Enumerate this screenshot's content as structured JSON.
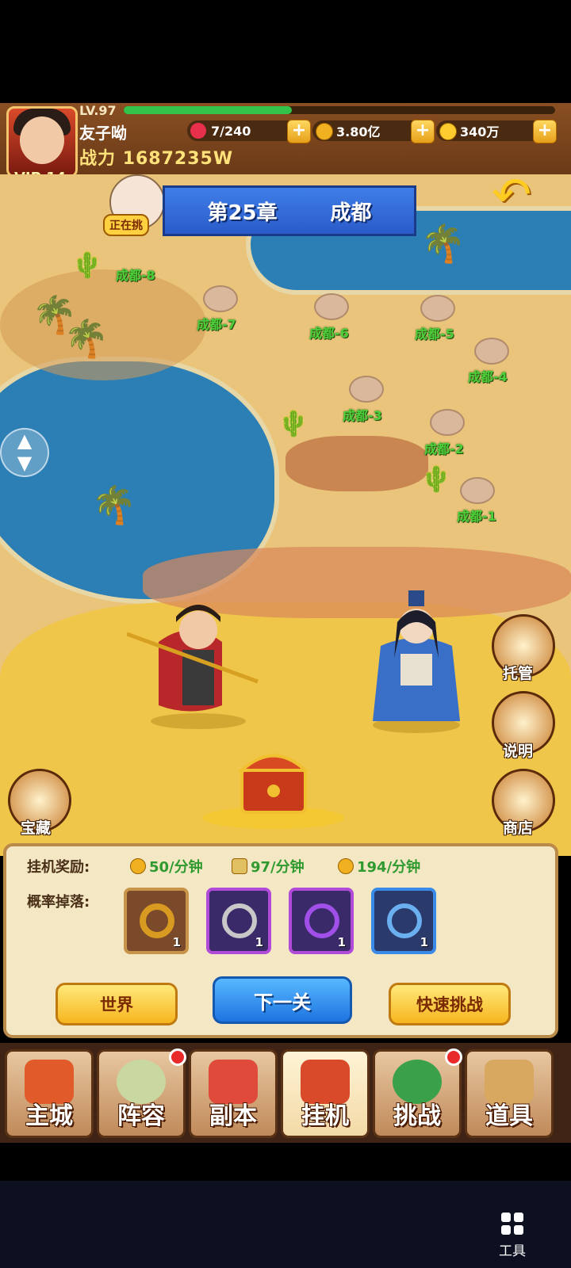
{
  "player": {
    "level": "LV.97",
    "xp_fraction": 0.39,
    "name": "友子呦",
    "power_label": "战力",
    "power_value": "1687235W",
    "vip": "VIP 14"
  },
  "resources": [
    {
      "name": "stamina",
      "icon": "heart-icon",
      "value": "7/240"
    },
    {
      "name": "silver",
      "icon": "coin-icon",
      "value": "3.80亿"
    },
    {
      "name": "gold",
      "icon": "gold-icon",
      "value": "340万"
    }
  ],
  "map": {
    "chapter": "第25章",
    "city": "成都",
    "current_tag": "正在挑",
    "stages": [
      "成都-1",
      "成都-2",
      "成都-3",
      "成都-4",
      "成都-5",
      "成都-6",
      "成都-7",
      "成都-8"
    ]
  },
  "side_buttons": {
    "auto": "托管",
    "info": "说明",
    "shop": "商店",
    "treasure": "宝藏"
  },
  "panel": {
    "idle_label": "挂机奖励:",
    "drop_label": "概率掉落:",
    "rates": [
      "50/分钟",
      "97/分钟",
      "194/分钟"
    ],
    "items": [
      {
        "name": "dragon-ring",
        "count": "1",
        "rarity": "orange"
      },
      {
        "name": "jade-ring",
        "count": "1",
        "rarity": "purple"
      },
      {
        "name": "purple-ring",
        "count": "1",
        "rarity": "purple"
      },
      {
        "name": "blue-ring",
        "count": "1",
        "rarity": "blue"
      }
    ],
    "btn_world": "世界",
    "btn_next": "下一关",
    "btn_quick": "快速挑战"
  },
  "nav": [
    {
      "label": "主城",
      "badge": false
    },
    {
      "label": "阵容",
      "badge": true
    },
    {
      "label": "副本",
      "badge": false
    },
    {
      "label": "挂机",
      "badge": false,
      "active": true
    },
    {
      "label": "挑战",
      "badge": true
    },
    {
      "label": "道具",
      "badge": false
    }
  ],
  "system": {
    "tools": "工具"
  },
  "colors": {
    "stage_label": "#4ccf3a",
    "xp_bar": "#33c24a",
    "banner": "#2a5bc9"
  }
}
